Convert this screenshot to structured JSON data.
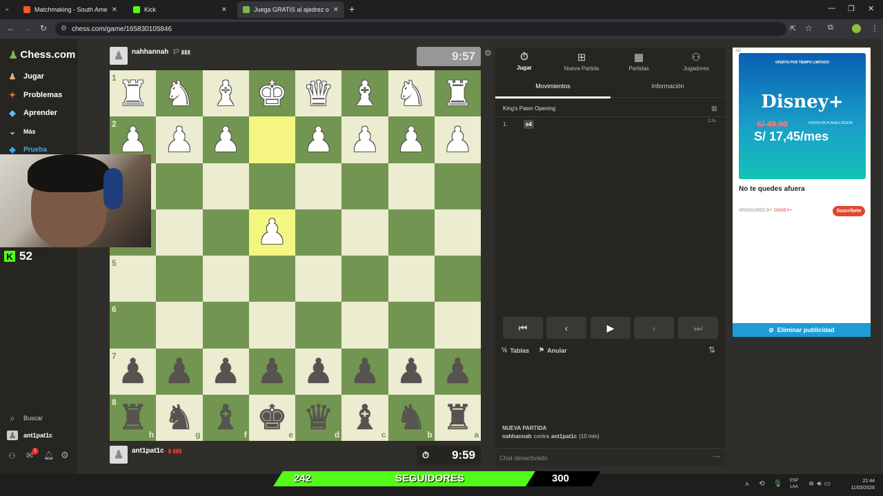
{
  "browser": {
    "tabs": [
      {
        "title": "Matchmaking - South America",
        "color": "#ff5a1f"
      },
      {
        "title": "Kick",
        "color": "#53fc18"
      },
      {
        "title": "Juega GRATIS al ajedrez on",
        "color": "#81b64c"
      }
    ],
    "url": "chess.com/game/165830105846"
  },
  "sidebar": {
    "logo": "Chess.com",
    "items": [
      {
        "label": "Jugar",
        "icon": "pawn-icon",
        "color": "#e7b072"
      },
      {
        "label": "Problemas",
        "icon": "puzzle-icon",
        "color": "#e96d36"
      },
      {
        "label": "Aprender",
        "icon": "cap-icon",
        "color": "#6bb6e6"
      },
      {
        "label": "Más",
        "icon": "chevron-down-icon",
        "color": "#ccc"
      },
      {
        "label": "Prueba",
        "icon": "diamond-icon",
        "color": "#3ca4e8"
      }
    ],
    "search": "Buscar",
    "user": "ant1pat1c",
    "mail_badge": "1"
  },
  "kick_overlay": {
    "count": "52"
  },
  "game": {
    "top_player": {
      "name": "nahhannah",
      "clock": "9:57"
    },
    "bottom_player": {
      "name": "ant1pat1c",
      "clock": "9:59"
    },
    "ranks": [
      "1",
      "2",
      "3",
      "4",
      "5",
      "6",
      "7",
      "8"
    ],
    "files": [
      "h",
      "g",
      "f",
      "e",
      "d",
      "c",
      "b",
      "a"
    ],
    "board": [
      [
        "wR",
        "wN",
        "wB",
        "wK",
        "wQ",
        "wB",
        "wN",
        "wR"
      ],
      [
        "wP",
        "wP",
        "wP",
        "",
        "wP",
        "wP",
        "wP",
        "wP"
      ],
      [
        "",
        "",
        "",
        "",
        "",
        "",
        "",
        ""
      ],
      [
        "",
        "",
        "",
        "wP",
        "",
        "",
        "",
        ""
      ],
      [
        "",
        "",
        "",
        "",
        "",
        "",
        "",
        ""
      ],
      [
        "",
        "",
        "",
        "",
        "",
        "",
        "",
        ""
      ],
      [
        "bP",
        "bP",
        "bP",
        "bP",
        "bP",
        "bP",
        "bP",
        "bP"
      ],
      [
        "bR",
        "bN",
        "bB",
        "bK",
        "bQ",
        "bB",
        "bN",
        "bR"
      ]
    ],
    "highlight": [
      [
        1,
        3
      ],
      [
        3,
        3
      ]
    ]
  },
  "panel": {
    "tabs": [
      {
        "label": "Jugar",
        "icon": "stopwatch-icon"
      },
      {
        "label": "Nueva Partida",
        "icon": "plus-icon"
      },
      {
        "label": "Partidas",
        "icon": "board-icon"
      },
      {
        "label": "Jugadores",
        "icon": "players-icon"
      }
    ],
    "subtabs": [
      "Movimientos",
      "Información"
    ],
    "opening": "King's Pawn Opening",
    "moves": [
      {
        "num": "1.",
        "white": "e4",
        "time": "2.2s"
      }
    ],
    "draw": "Tablas",
    "abort": "Anular",
    "new_game_title": "NUEVA PARTIDA",
    "new_game_desc_player1": "nahhannah",
    "new_game_desc_mid": "contra",
    "new_game_desc_player2": "ant1pat1c",
    "new_game_desc_time": "(10 min)",
    "chat": "Chat desactivado"
  },
  "ad": {
    "tag": "AD",
    "banner_top": "OFERTA POR TIEMPO LIMITADO",
    "brand": "Disney+",
    "old_price": "S/ 49,90",
    "old_price_note": "DISFRUTA PLANES DESDE",
    "new_price": "S/ 17,45/mes",
    "headline": "No te quedes afuera",
    "sponsor_prefix": "SPONSORED BY",
    "sponsor_name": "DISNEY+",
    "cta": "Suscríbete",
    "remove": "Eliminar publicidad"
  },
  "stream_bar": {
    "left": "242",
    "center": "SEGUIDORES",
    "right": "300"
  },
  "taskbar": {
    "lang1": "ESP",
    "lang2": "LAA",
    "time": "21:44",
    "date": "11/03/2026"
  }
}
